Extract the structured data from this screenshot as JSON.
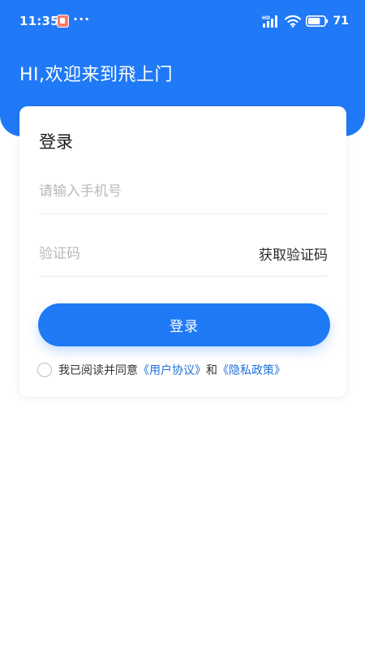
{
  "status_bar": {
    "time": "11:35",
    "more": "···",
    "battery": "71",
    "icons": [
      "notification-app-icon",
      "hd-signal-icon",
      "wifi-icon",
      "battery-icon"
    ]
  },
  "header": {
    "welcome": "HI,欢迎来到飛上门"
  },
  "login_card": {
    "title": "登录",
    "phone_placeholder": "请输入手机号",
    "phone_value": "",
    "code_placeholder": "验证码",
    "code_value": "",
    "get_code_label": "获取验证码",
    "login_label": "登录",
    "agreement": {
      "prefix": "我已阅读并同意",
      "user_agreement": "《用户协议》",
      "conjunction": "和",
      "privacy_policy": "《隐私政策》",
      "checked": false
    }
  },
  "colors": {
    "primary": "#1f7af5",
    "link": "#1f6fd8",
    "placeholder": "#b8b8b8",
    "background": "#ffffff"
  }
}
